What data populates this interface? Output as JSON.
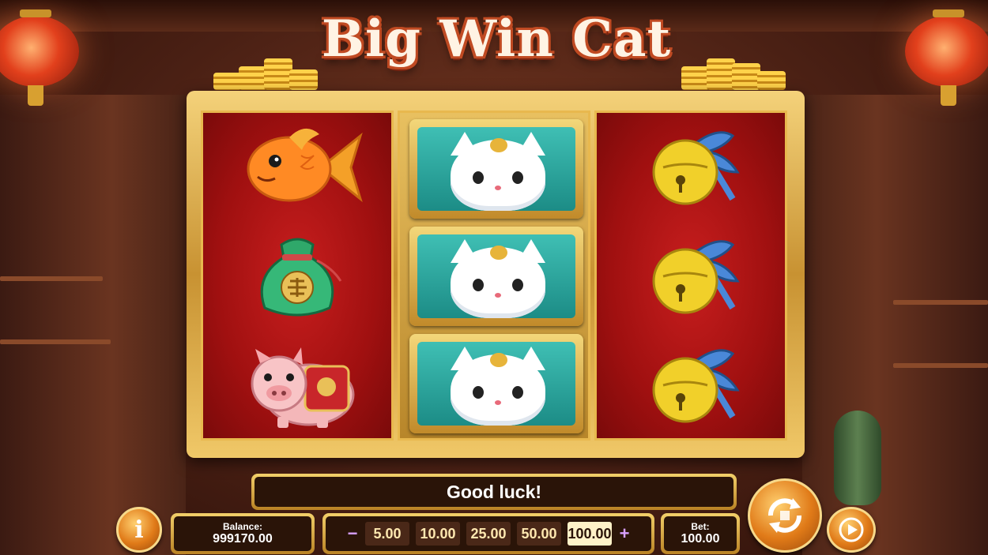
{
  "game": {
    "title": "Big Win Cat"
  },
  "reels": [
    {
      "symbols": [
        "goldfish",
        "lucky-bag",
        "pig"
      ]
    },
    {
      "symbols": [
        "lucky-cat",
        "lucky-cat",
        "lucky-cat"
      ]
    },
    {
      "symbols": [
        "golden-bell",
        "golden-bell",
        "golden-bell"
      ]
    }
  ],
  "message": "Good luck!",
  "balance": {
    "label": "Balance:",
    "value": "999170.00"
  },
  "bet_selector": {
    "minus": "−",
    "plus": "+",
    "options": [
      "5.00",
      "10.00",
      "25.00",
      "50.00",
      "100.00"
    ],
    "selected": "100.00"
  },
  "bet": {
    "label": "Bet:",
    "value": "100.00"
  },
  "buttons": {
    "info": "i"
  },
  "colors": {
    "reel_red": "#b01414",
    "frame_gold": "#e0b050",
    "panel_dark": "#2a1408",
    "cat_tile_teal": "#2aa8a0"
  }
}
